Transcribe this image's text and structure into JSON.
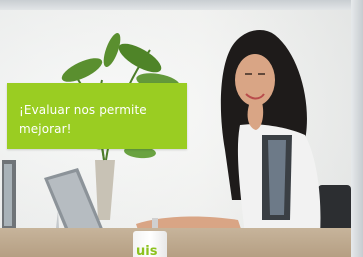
{
  "banner": {
    "line1": "¡Evaluar nos permite",
    "line2": "mejorar!"
  },
  "mug": {
    "logo_text": "uis"
  },
  "colors": {
    "banner_bg": "#9acd22",
    "banner_text": "#ffffff",
    "logo": "#8dc21f"
  }
}
